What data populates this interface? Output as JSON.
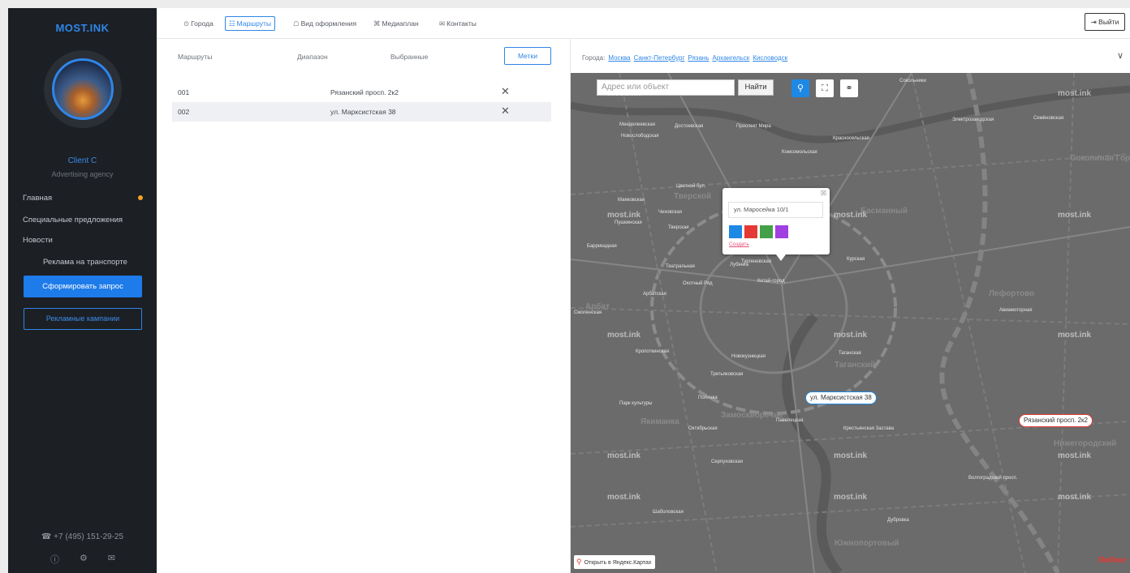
{
  "sidebar": {
    "logo": "MOST.INK",
    "user_name": "Client C",
    "user_role": "Advertising agency",
    "nav": [
      {
        "label": "Главная"
      },
      {
        "label": "Специальные предложения"
      },
      {
        "label": "Новости"
      }
    ],
    "sub_item": "Реклама на транспорте",
    "primary_button": "Сформировать запрос",
    "secondary_button": "Рекламные кампании",
    "phone": "☎ +7 (495) 151-29-25",
    "icons": [
      "help-icon",
      "settings-icon",
      "mail-icon"
    ]
  },
  "topnav": {
    "tabs": [
      {
        "icon": "⊙",
        "label": "Города"
      },
      {
        "icon": "☷",
        "label": "Маршруты"
      },
      {
        "icon": "☖",
        "label": "Вид оформления"
      },
      {
        "icon": "⌘",
        "label": "Медиаплан"
      },
      {
        "icon": "✉",
        "label": "Контакты"
      }
    ],
    "logout": "⇥ Выйти"
  },
  "routes": {
    "headers": [
      "Маршруты",
      "Диапазон",
      "Выбранные"
    ],
    "tags_button": "Метки",
    "rows": [
      {
        "id": "001",
        "address": "Рязанский просп. 2к2"
      },
      {
        "id": "002",
        "address": "ул. Марксистская 38"
      }
    ]
  },
  "map": {
    "cities_label": "Города:",
    "cities": [
      "Москва",
      "Санкт-Петербург",
      "Рязань",
      "Архангельск",
      "Кисловодск"
    ],
    "search_placeholder": "Адрес или объект",
    "search_button": "Найти",
    "popup": {
      "value": "ул. Маросейка 10/1",
      "create": "Создать",
      "colors": [
        "#1e88e5",
        "#e53935",
        "#43a047",
        "#a040e0"
      ]
    },
    "markers": [
      "ул. Марксистская 38",
      "Рязанский просп. 2к2"
    ],
    "open_yandex": "Открыть в Яндекс.Картах",
    "yandex_logo": "Яндекс",
    "watermark": "most.ink",
    "districts": [
      "Тверской",
      "Басманный",
      "Соколиная Гора",
      "Лефортово",
      "Замоскворечье",
      "Якиманка",
      "Арбат",
      "Таганский",
      "Нижегородский",
      "Южнопортовый"
    ],
    "streets": [
      "Менделеевская",
      "Достоевская",
      "Проспект Мира",
      "Красносельская",
      "Сокольники",
      "Электрозаводская",
      "Семёновская",
      "Новослободская",
      "Комсомольская",
      "Цветной бул.",
      "Маяковская",
      "Чеховская",
      "Пушкинская",
      "Тверская",
      "Баррикадная",
      "Тургеневская",
      "Курская",
      "Театральная",
      "Лубянка",
      "Китай-город",
      "Охотный Ряд",
      "Арбатская",
      "Смоленская",
      "Кропоткинская",
      "Новокузнецкая",
      "Таганская",
      "Третьяковская",
      "Парк культуры",
      "Полянка",
      "Павелецкая",
      "Октябрьская",
      "Серпуховская",
      "Шаболовская",
      "Крестьянская Застава",
      "Дубровка",
      "Волгоградский просп.",
      "Авиамоторная"
    ]
  }
}
